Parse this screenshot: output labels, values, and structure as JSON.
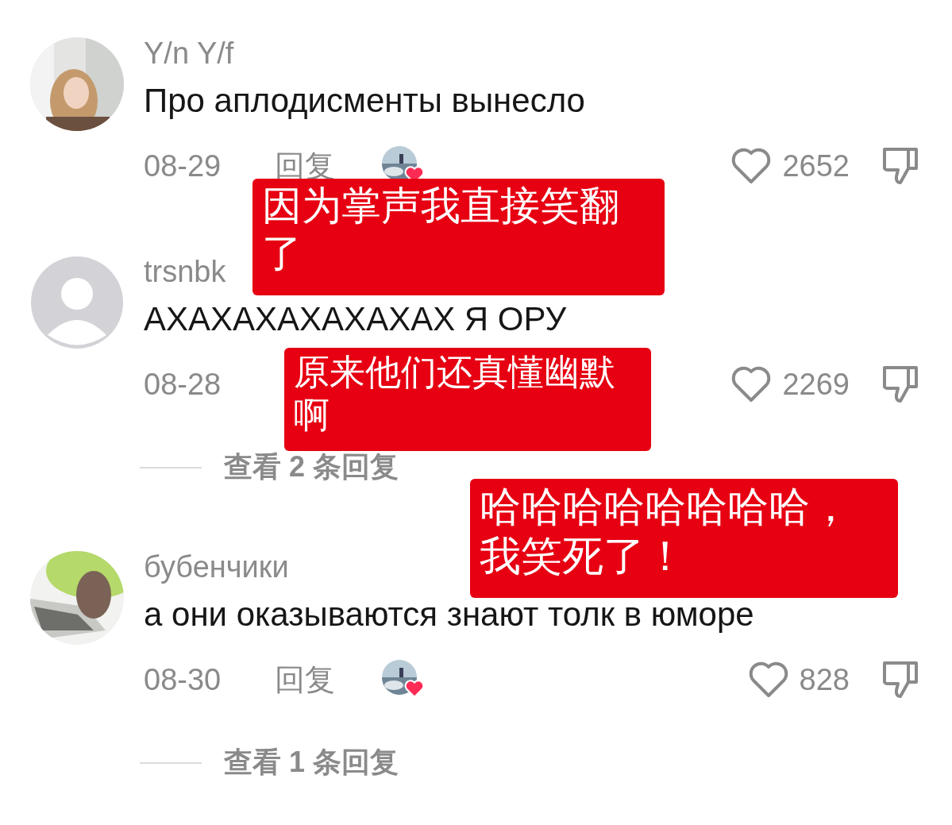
{
  "comments": [
    {
      "username": "Y/n Y/f",
      "text": "Про аплодисменты вынесло",
      "date": "08-29",
      "reply": "回复",
      "creator_liked": true,
      "likes": "2652"
    },
    {
      "avatar": {
        "kind": "default"
      },
      "username": "trsnbk",
      "text": "АХАХАХАХАХАХАХ Я ОРУ",
      "date": "08-28",
      "likes": "2269",
      "view_replies": "查看 2 条回复"
    },
    {
      "username": "бубенчики",
      "text": "а они оказываются знают толк в юморе",
      "date": "08-30",
      "reply": "回复",
      "creator_liked": true,
      "likes": "828",
      "view_replies": "查看 1 条回复"
    }
  ],
  "annotations": [
    {
      "text": "因为掌声我直接笑翻了"
    },
    {
      "text": "原来他们还真懂幽默啊"
    },
    {
      "text": "哈哈哈哈哈哈哈哈，我笑死了！"
    }
  ]
}
